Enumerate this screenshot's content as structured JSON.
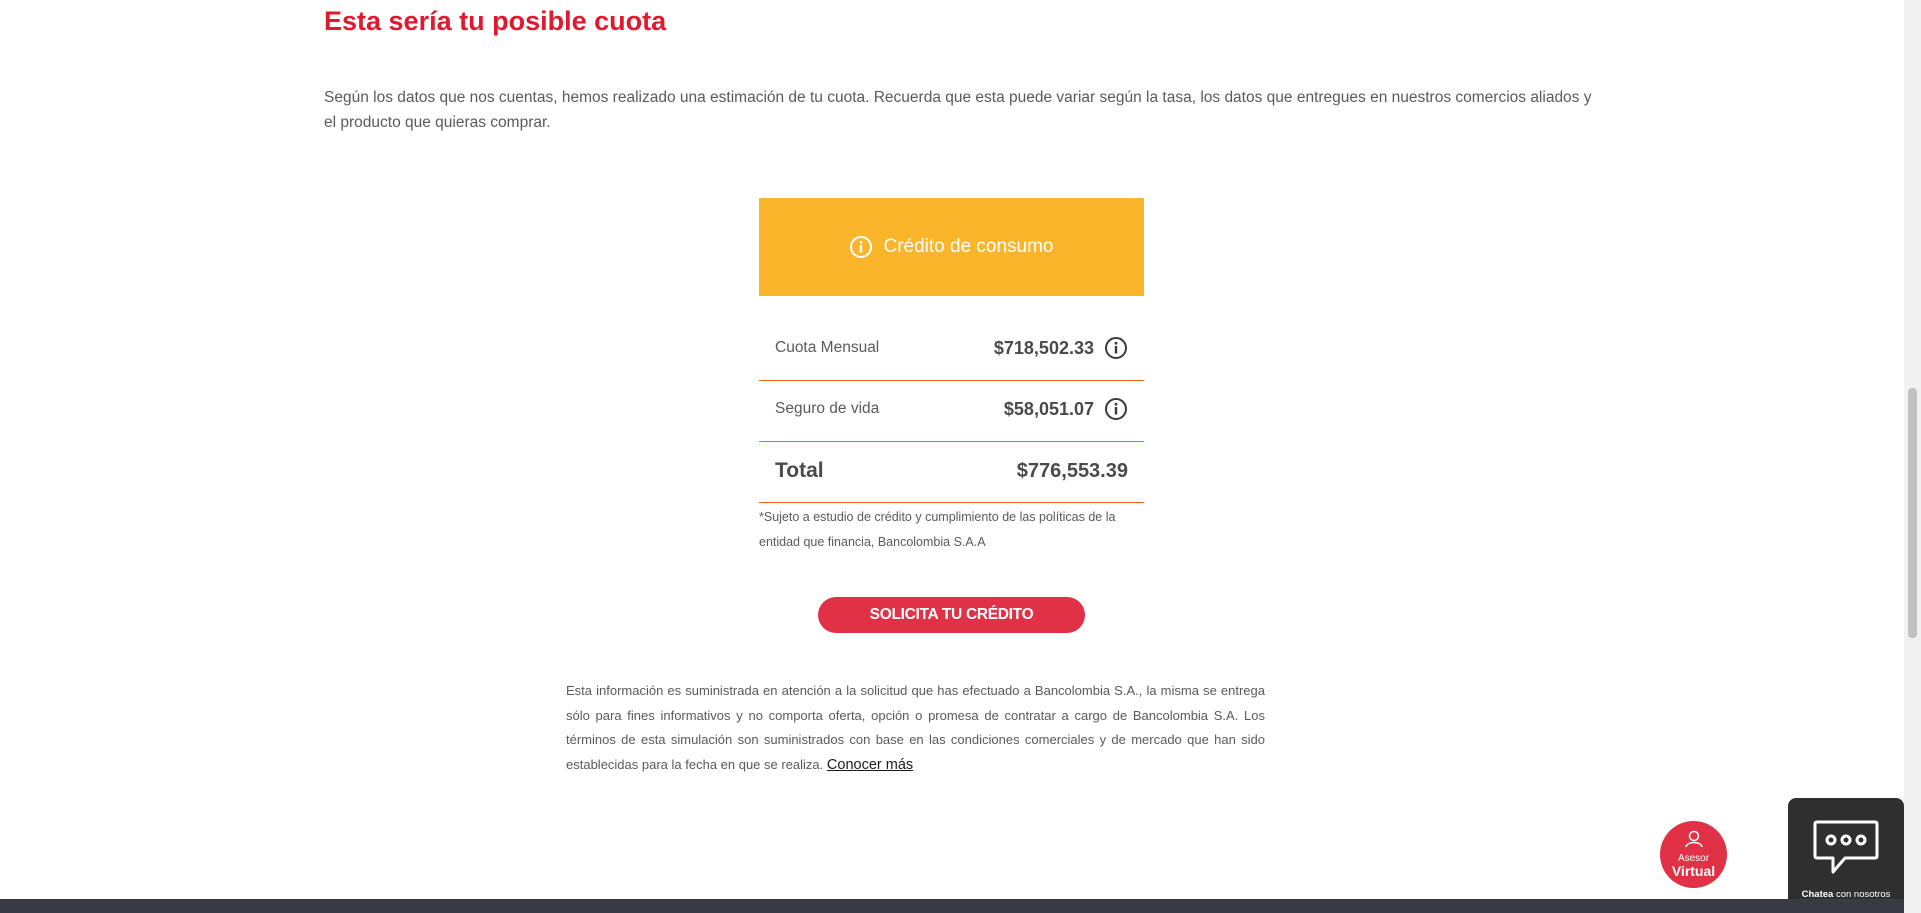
{
  "heading": "Esta sería tu posible cuota",
  "intro": "Según los datos que nos cuentas, hemos realizado una estimación de tu cuota. Recuerda que esta puede variar según la tasa, los datos que entregues en nuestros comercios aliados y el producto que quieras comprar.",
  "card": {
    "title": "Crédito de consumo",
    "rows": [
      {
        "label": "Cuota Mensual",
        "value": "$718,502.33"
      },
      {
        "label": "Seguro de vida",
        "value": "$58,051.07"
      },
      {
        "label": "Total",
        "value": "$776,553.39"
      }
    ],
    "disclaimer": "*Sujeto a estudio de crédito y cumplimiento de las políticas de la entidad que financia, Bancolombia S.A.A"
  },
  "cta_label": "SOLICITA TU CRÉDITO",
  "legal": {
    "text": "Esta información es suministrada en atención a la solicitud que has efectuado a Bancolombia S.A., la misma se entrega sólo para fines informativos y no comporta oferta, opción o promesa de contratar a cargo de Bancolombia S.A. Los términos de esta simulación son suministrados con base en las condiciones comerciales y de mercado que han sido establecidas para la fecha en que se realiza.",
    "link": "Conocer más"
  },
  "asesor": {
    "line1": "Asesor",
    "line2": "Virtual"
  },
  "chat": {
    "bold": "Chatea",
    "rest": "con nosotros"
  },
  "colors": {
    "accent_red": "#e1192e",
    "button_red": "#e03146",
    "header_yellow": "#fbb52a",
    "divider_orange": "#f26522"
  },
  "icons": [
    "info-icon",
    "avatar-icon",
    "chat-bubble-icon"
  ]
}
